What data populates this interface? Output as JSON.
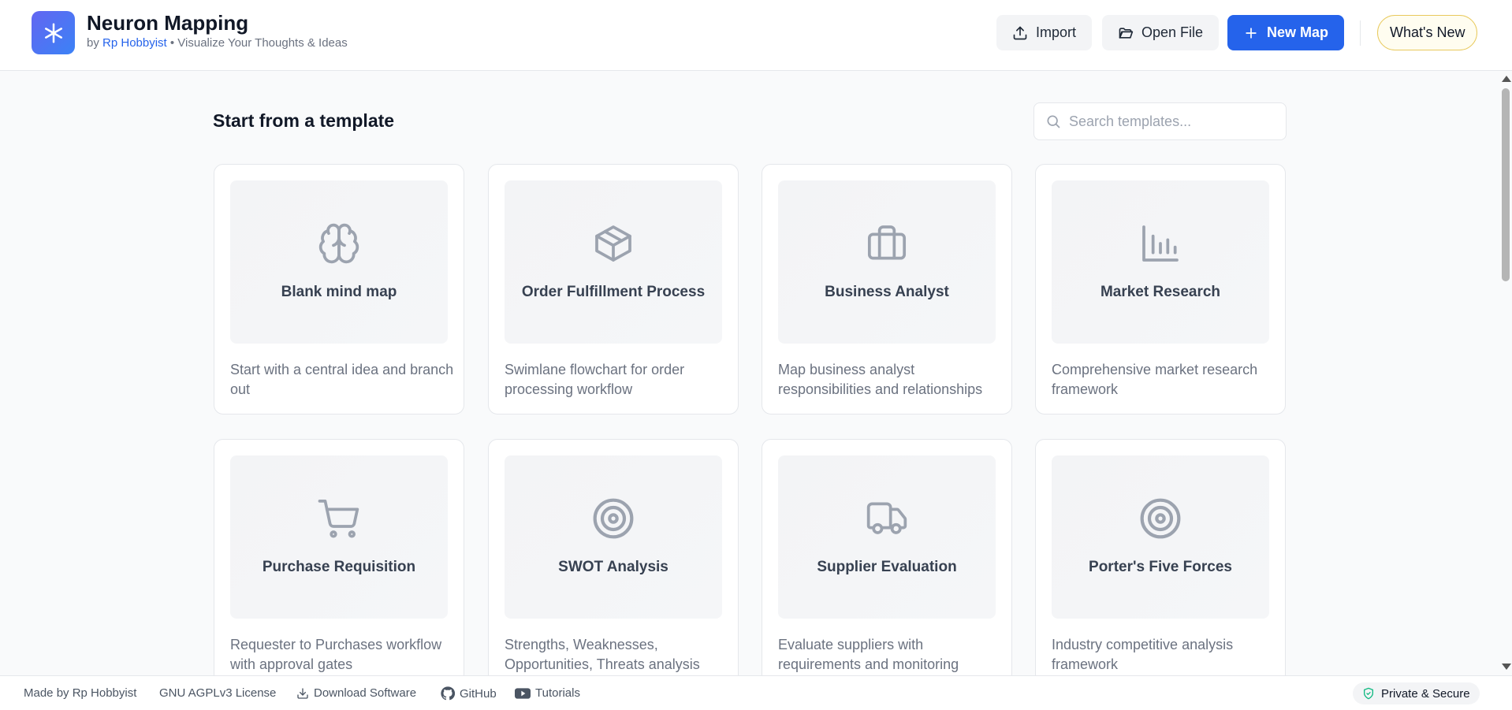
{
  "app": {
    "title": "Neuron Mapping",
    "by": "by",
    "author": "Rp Hobbyist",
    "tagline": " • Visualize Your Thoughts & Ideas",
    "logo_icon": "sparkle-icon"
  },
  "header": {
    "import_label": "Import",
    "open_file_label": "Open File",
    "new_map_label": "New Map",
    "whats_new_label": "What's New"
  },
  "main": {
    "section_title": "Start from a template",
    "search_placeholder": "Search templates..."
  },
  "templates": [
    {
      "name": "Blank mind map",
      "description": "Start with a central idea and branch out",
      "icon": "brain-icon"
    },
    {
      "name": "Order Fulfillment Process",
      "description": "Swimlane flowchart for order processing workflow",
      "icon": "package-icon"
    },
    {
      "name": "Business Analyst",
      "description": "Map business analyst responsibilities and relationships",
      "icon": "briefcase-icon"
    },
    {
      "name": "Market Research",
      "description": "Comprehensive market research framework",
      "icon": "bar-chart-icon"
    },
    {
      "name": "Purchase Requisition",
      "description": "Requester to Purchases workflow with approval gates",
      "icon": "shopping-cart-icon"
    },
    {
      "name": "SWOT Analysis",
      "description": "Strengths, Weaknesses, Opportunities, Threats analysis",
      "icon": "target-icon"
    },
    {
      "name": "Supplier Evaluation",
      "description": "Evaluate suppliers with requirements and monitoring",
      "icon": "truck-icon"
    },
    {
      "name": "Porter's Five Forces",
      "description": "Industry competitive analysis framework",
      "icon": "target-icon"
    }
  ],
  "footer": {
    "made_by": "Made by Rp Hobbyist",
    "license": "GNU AGPLv3 License",
    "download": "Download Software",
    "github": "GitHub",
    "tutorials": "Tutorials",
    "secure": "Private & Secure"
  },
  "colors": {
    "accent": "#2563eb",
    "secure_icon": "#10b981"
  }
}
